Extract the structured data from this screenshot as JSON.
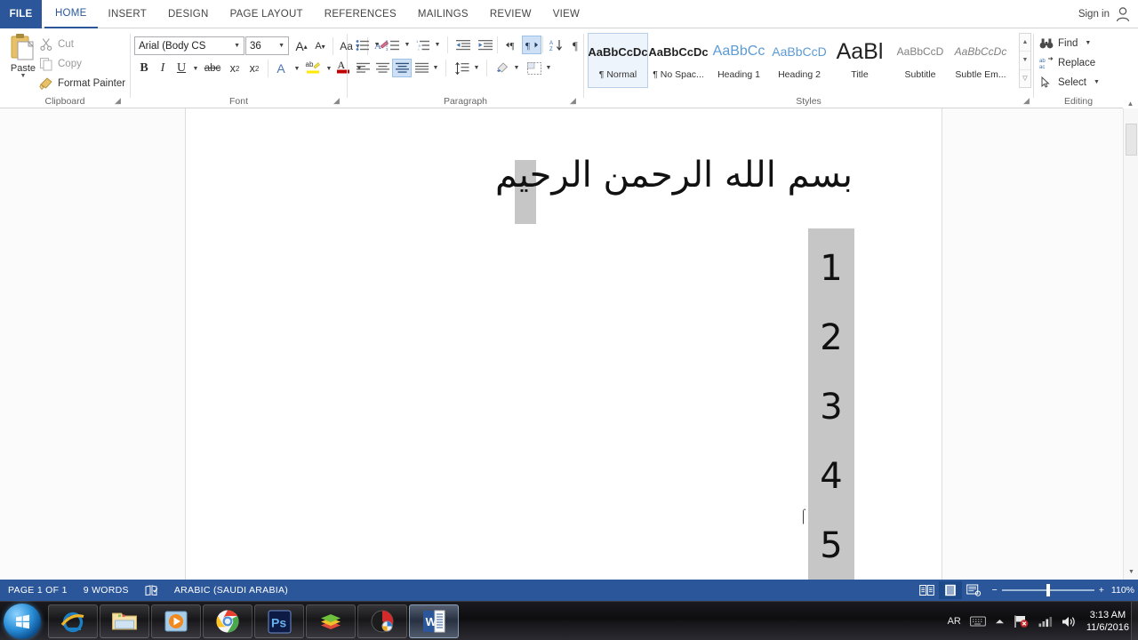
{
  "window": {
    "app": "Microsoft Word",
    "file_tab": "FILE",
    "signin": "Sign in",
    "signin_icon": "user-icon"
  },
  "ribbon": {
    "tabs": [
      {
        "label": "HOME",
        "active": true
      },
      {
        "label": "INSERT",
        "active": false
      },
      {
        "label": "DESIGN",
        "active": false
      },
      {
        "label": "PAGE LAYOUT",
        "active": false
      },
      {
        "label": "REFERENCES",
        "active": false
      },
      {
        "label": "MAILINGS",
        "active": false
      },
      {
        "label": "REVIEW",
        "active": false
      },
      {
        "label": "VIEW",
        "active": false
      }
    ],
    "collapse_icon": "chevron-up-icon",
    "groups": {
      "clipboard": {
        "label": "Clipboard",
        "paste": "Paste",
        "cut": "Cut",
        "copy": "Copy",
        "format_painter": "Format Painter",
        "launcher_icon": "dialog-launcher-icon"
      },
      "font": {
        "label": "Font",
        "font_name": "Arial (Body CS",
        "font_size": "36",
        "grow_font": "A",
        "shrink_font": "A",
        "change_case": "Aa",
        "clear_formatting_icon": "clear-formatting-icon",
        "bold": "B",
        "italic": "I",
        "underline": "U",
        "strikethrough": "abc",
        "subscript": "x",
        "subscript_sub": "2",
        "superscript": "x",
        "superscript_sup": "2",
        "text_effects": "A",
        "highlight": "ab",
        "font_color": "A",
        "launcher_icon": "dialog-launcher-icon"
      },
      "paragraph": {
        "label": "Paragraph",
        "bullets_icon": "bullets-icon",
        "numbering_icon": "numbering-icon",
        "multilevel_icon": "multilevel-list-icon",
        "decrease_indent_icon": "decrease-indent-icon",
        "increase_indent_icon": "increase-indent-icon",
        "ltr_icon": "left-to-right-icon",
        "rtl_icon": "right-to-left-icon",
        "sort_icon": "sort-icon",
        "show_marks_icon": "show-formatting-marks-icon",
        "align_left_icon": "align-left-icon",
        "align_center_icon": "align-center-icon",
        "align_right_icon": "align-right-icon",
        "justify_icon": "justify-icon",
        "line_spacing_icon": "line-spacing-icon",
        "shading_icon": "shading-icon",
        "borders_icon": "borders-icon",
        "selected": [
          "right-to-left-icon",
          "align-center-icon"
        ],
        "launcher_icon": "dialog-launcher-icon"
      },
      "styles": {
        "label": "Styles",
        "items": [
          {
            "preview": "AaBbCcDc",
            "name": "¶ Normal",
            "selected": true
          },
          {
            "preview": "AaBbCcDc",
            "name": "¶ No Spac...",
            "selected": false
          },
          {
            "preview": "AaBbCc",
            "name": "Heading 1",
            "selected": false
          },
          {
            "preview": "AaBbCcD",
            "name": "Heading 2",
            "selected": false
          },
          {
            "preview": "AaBl",
            "name": "Title",
            "selected": false
          },
          {
            "preview": "AaBbCcD",
            "name": "Subtitle",
            "selected": false
          },
          {
            "preview": "AaBbCcDc",
            "name": "Subtle Em...",
            "selected": false
          }
        ],
        "scroll_up_icon": "chevron-up-icon",
        "scroll_down_icon": "chevron-down-icon",
        "more_icon": "more-styles-icon",
        "launcher_icon": "dialog-launcher-icon"
      },
      "editing": {
        "label": "Editing",
        "find": "Find",
        "replace": "Replace",
        "select": "Select",
        "find_icon": "binoculars-icon",
        "replace_icon": "replace-icon",
        "select_icon": "cursor-select-icon"
      }
    }
  },
  "document": {
    "arabic_text": "بسم الله الرحمن الرحيم",
    "numbers": [
      "1",
      "2",
      "3",
      "4",
      "5"
    ],
    "selection_color": "#c6c6c6",
    "cursor_icon": "i-beam-cursor"
  },
  "scrollbar": {
    "up_icon": "chevron-up-icon",
    "down_icon": "chevron-down-icon"
  },
  "status_bar": {
    "page": "PAGE 1 OF 1",
    "words": "9 WORDS",
    "proofing_icon": "proofing-errors-icon",
    "language": "ARABIC (SAUDI ARABIA)",
    "read_mode_icon": "read-mode-icon",
    "print_layout_icon": "print-layout-icon",
    "web_layout_icon": "web-layout-icon",
    "zoom_out": "−",
    "zoom_in": "+",
    "zoom_value": "110%",
    "accent_color": "#2b579a"
  },
  "taskbar": {
    "start_icon": "windows-start-orb-icon",
    "items": [
      {
        "icon": "internet-explorer-icon",
        "active": false
      },
      {
        "icon": "file-explorer-icon",
        "active": false
      },
      {
        "icon": "windows-media-player-icon",
        "active": false
      },
      {
        "icon": "google-chrome-icon",
        "active": false
      },
      {
        "icon": "photoshop-icon",
        "active": false
      },
      {
        "icon": "stacked-layers-icon",
        "active": false
      },
      {
        "icon": "recorder-icon",
        "active": false
      },
      {
        "icon": "microsoft-word-icon",
        "active": true
      }
    ],
    "tray": {
      "language": "AR",
      "keyboard_icon": "keyboard-icon",
      "show_hidden_icon": "show-hidden-icons-icon",
      "action_center_icon": "flag-warning-icon",
      "network_icon": "network-signal-icon",
      "volume_icon": "volume-icon",
      "time": "3:13 AM",
      "date": "11/6/2016",
      "show_desktop_icon": "show-desktop-icon"
    }
  }
}
